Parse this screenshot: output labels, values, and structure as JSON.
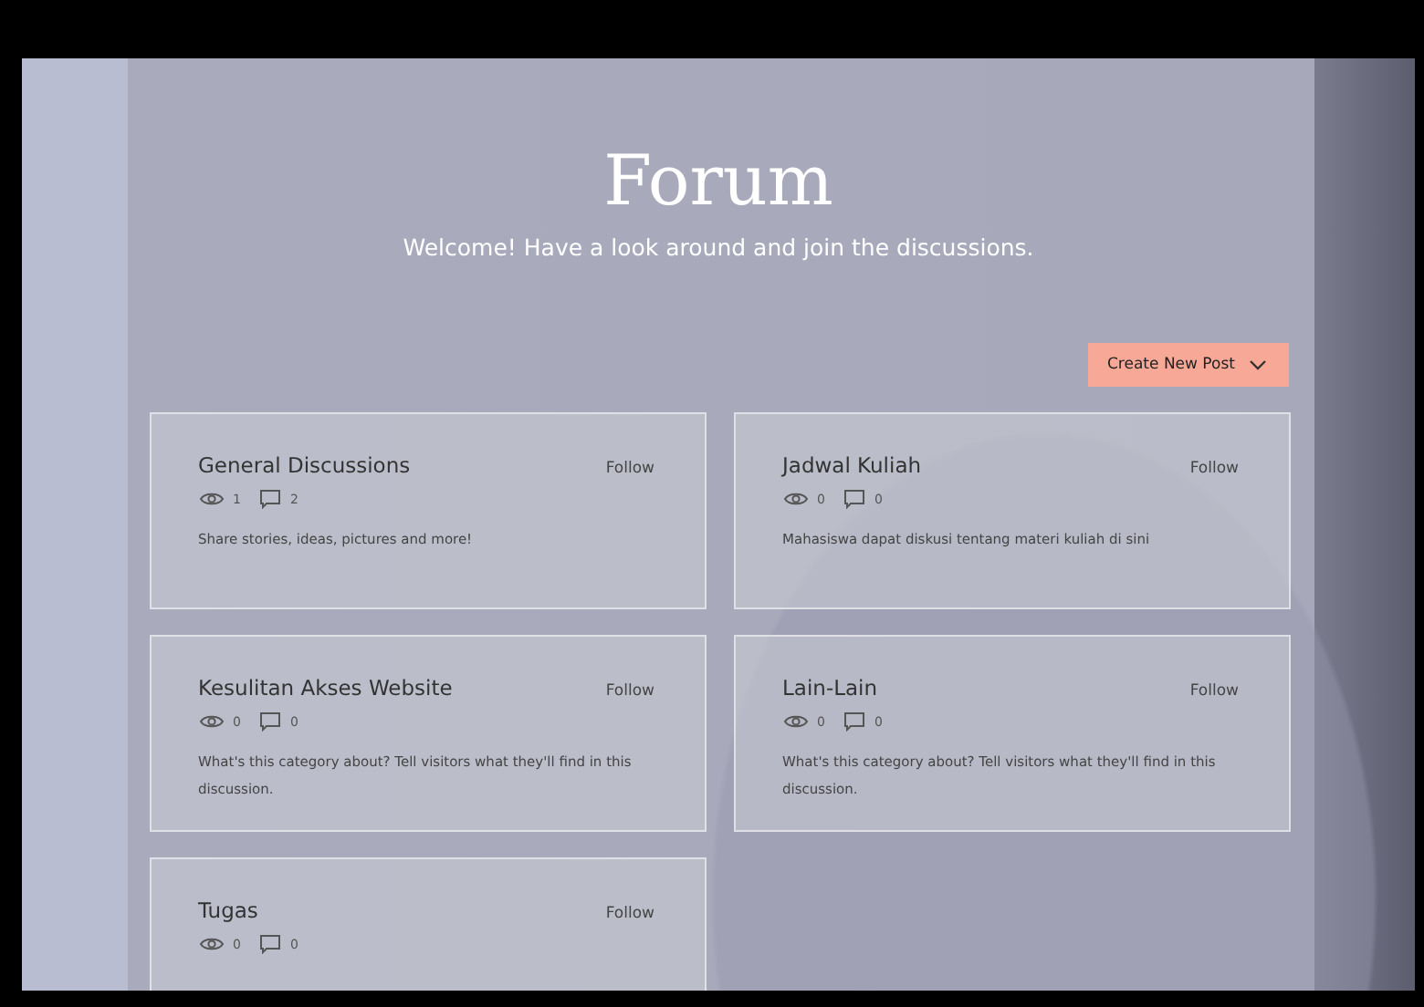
{
  "header": {
    "title": "Forum",
    "subtitle": "Welcome! Have a look around and join the discussions."
  },
  "create_button": {
    "label": "Create New Post"
  },
  "categories": [
    {
      "title": "General Discussions",
      "follow": "Follow",
      "views": "1",
      "comments": "2",
      "description": "Share stories, ideas, pictures and more!"
    },
    {
      "title": "Jadwal Kuliah",
      "follow": "Follow",
      "views": "0",
      "comments": "0",
      "description": "Mahasiswa dapat diskusi tentang materi kuliah di sini"
    },
    {
      "title": "Kesulitan Akses Website",
      "follow": "Follow",
      "views": "0",
      "comments": "0",
      "description": "What's this category about? Tell visitors what they'll find in this discussion."
    },
    {
      "title": "Lain-Lain",
      "follow": "Follow",
      "views": "0",
      "comments": "0",
      "description": "What's this category about? Tell visitors what they'll find in this discussion."
    },
    {
      "title": "Tugas",
      "follow": "Follow",
      "views": "0",
      "comments": "0"
    }
  ]
}
